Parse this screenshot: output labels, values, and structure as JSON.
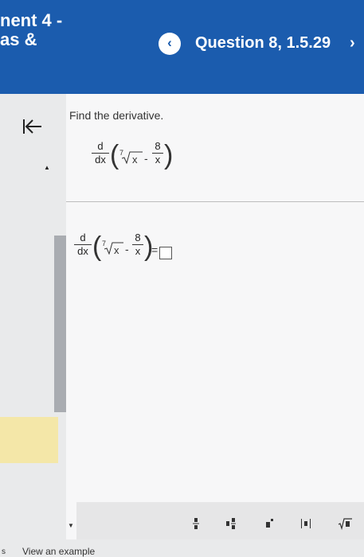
{
  "header": {
    "course_title": "nent 4 -\nas &",
    "question_title": "Question 8, 1.5.29",
    "prev_label": "‹",
    "next_label": "›"
  },
  "problem": {
    "prompt": "Find the derivative.",
    "operator_num": "d",
    "operator_den": "dx",
    "root_index": "7",
    "radicand": "x",
    "minus": "-",
    "frac_num": "8",
    "frac_den": "x"
  },
  "answer": {
    "operator_num": "d",
    "operator_den": "dx",
    "root_index": "7",
    "radicand": "x",
    "minus": "-",
    "frac_num": "8",
    "frac_den": "x",
    "equals": "=",
    "value": ""
  },
  "footer": {
    "view_example": "View an example"
  },
  "toolbar": {
    "tools": [
      "fraction-icon",
      "mixed-number-icon",
      "exponent-icon",
      "absolute-value-icon",
      "sqrt-icon"
    ]
  },
  "colors": {
    "header_bg": "#1b5cae",
    "hint_bg": "#f4e7a8"
  }
}
